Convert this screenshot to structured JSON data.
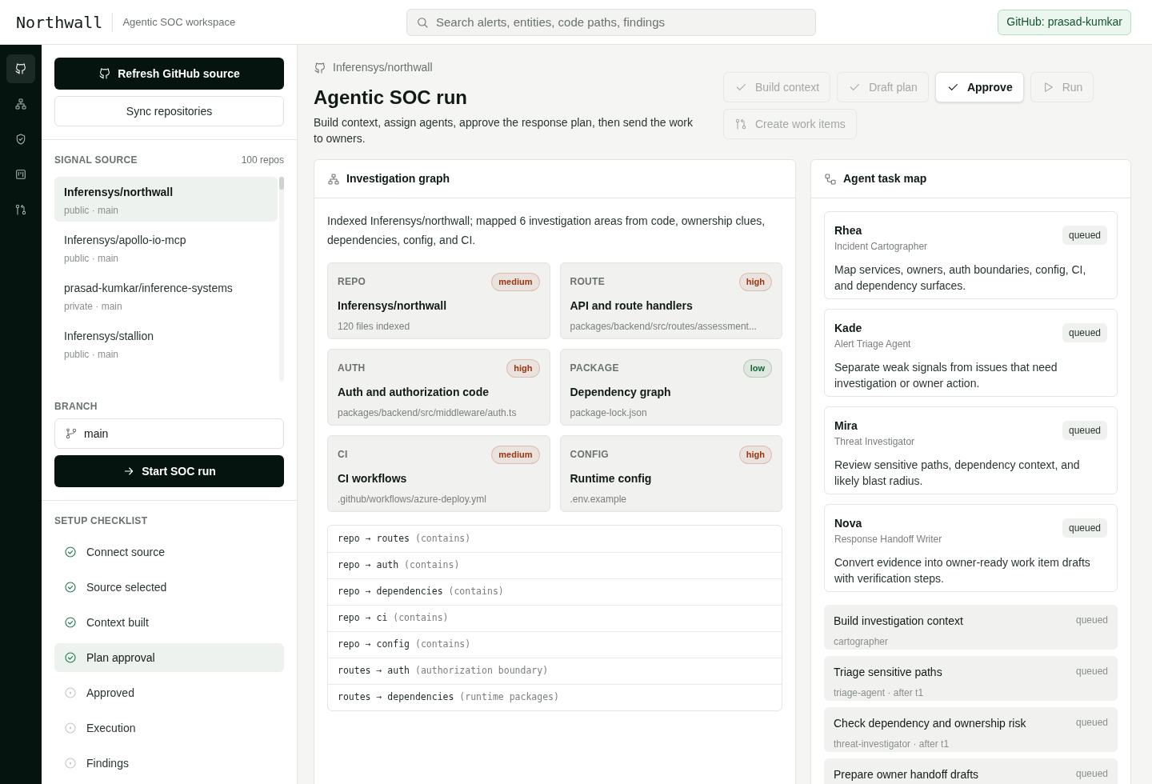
{
  "header": {
    "logo": "Northwall",
    "subtitle": "Agentic SOC workspace",
    "search_placeholder": "Search alerts, entities, code paths, findings",
    "account": "GitHub: prasad-kumkar"
  },
  "rail": [
    {
      "kind": "github",
      "selected": true
    },
    {
      "kind": "graph",
      "selected": false
    },
    {
      "kind": "shield",
      "selected": false
    },
    {
      "kind": "board",
      "selected": false
    },
    {
      "kind": "pull",
      "selected": false
    }
  ],
  "sidebar": {
    "refresh_button": "Refresh GitHub source",
    "sync_button": "Sync repositories",
    "source_label": "SIGNAL SOURCE",
    "source_count": "100 repos",
    "repos": [
      {
        "name": "Inferensys/northwall",
        "meta": "public · main",
        "selected": true
      },
      {
        "name": "Inferensys/apollo-io-mcp",
        "meta": "public · main",
        "selected": false
      },
      {
        "name": "prasad-kumkar/inference-systems",
        "meta": "private · main",
        "selected": false
      },
      {
        "name": "Inferensys/stallion",
        "meta": "public · main",
        "selected": false
      }
    ],
    "branch_label": "BRANCH",
    "branch_value": "main",
    "start_button": "Start SOC run",
    "checklist_label": "SETUP CHECKLIST",
    "checklist": [
      {
        "label": "Connect source",
        "done": true,
        "selected": false
      },
      {
        "label": "Source selected",
        "done": true,
        "selected": false
      },
      {
        "label": "Context built",
        "done": true,
        "selected": false
      },
      {
        "label": "Plan approval",
        "done": true,
        "selected": true
      },
      {
        "label": "Approved",
        "done": false,
        "selected": false
      },
      {
        "label": "Execution",
        "done": false,
        "selected": false
      },
      {
        "label": "Findings",
        "done": false,
        "selected": false
      }
    ]
  },
  "main": {
    "breadcrumb": "Inferensys/northwall",
    "title": "Agentic SOC run",
    "description": "Build context, assign agents, approve the response plan, then send the work to owners.",
    "actions": [
      {
        "label": "Build context",
        "kind": "check",
        "disabled": true
      },
      {
        "label": "Draft plan",
        "kind": "check",
        "disabled": true
      },
      {
        "label": "Approve",
        "kind": "check",
        "disabled": false
      },
      {
        "label": "Run",
        "kind": "play",
        "disabled": true
      },
      {
        "label": "Create work items",
        "kind": "handoff",
        "disabled": true
      }
    ]
  },
  "investigation": {
    "title": "Investigation graph",
    "summary": "Indexed Inferensys/northwall; mapped 6 investigation areas from code, ownership clues, dependencies, config, and CI.",
    "areas": [
      {
        "type": "REPO",
        "severity": "medium",
        "color": "#9a3412",
        "title": "Inferensys/northwall",
        "detail": "120 files indexed"
      },
      {
        "type": "ROUTE",
        "severity": "high",
        "color": "#9a3412",
        "title": "API and route handlers",
        "detail": "packages/backend/src/routes/assessment..."
      },
      {
        "type": "AUTH",
        "severity": "high",
        "color": "#9a3412",
        "title": "Auth and authorization code",
        "detail": "packages/backend/src/middleware/auth.ts"
      },
      {
        "type": "PACKAGE",
        "severity": "low",
        "color": "#166534",
        "title": "Dependency graph",
        "detail": "package-lock.json"
      },
      {
        "type": "CI",
        "severity": "medium",
        "color": "#9a3412",
        "title": "CI workflows",
        "detail": ".github/workflows/azure-deploy.yml"
      },
      {
        "type": "CONFIG",
        "severity": "high",
        "color": "#9a3412",
        "title": "Runtime config",
        "detail": ".env.example"
      }
    ],
    "edges": [
      {
        "from": "repo",
        "arrow": "→",
        "to": "routes",
        "relation": "(contains)"
      },
      {
        "from": "repo",
        "arrow": "→",
        "to": "auth",
        "relation": "(contains)"
      },
      {
        "from": "repo",
        "arrow": "→",
        "to": "dependencies",
        "relation": "(contains)"
      },
      {
        "from": "repo",
        "arrow": "→",
        "to": "ci",
        "relation": "(contains)"
      },
      {
        "from": "repo",
        "arrow": "→",
        "to": "config",
        "relation": "(contains)"
      },
      {
        "from": "routes",
        "arrow": "→",
        "to": "auth",
        "relation": "(authorization boundary)"
      },
      {
        "from": "routes",
        "arrow": "→",
        "to": "dependencies",
        "relation": "(runtime packages)"
      }
    ]
  },
  "agents": {
    "title": "Agent task map",
    "agents": [
      {
        "name": "Rhea",
        "role": "Incident Cartographer",
        "status": "queued",
        "task": "Map services, owners, auth boundaries, config, CI, and dependency surfaces."
      },
      {
        "name": "Kade",
        "role": "Alert Triage Agent",
        "status": "queued",
        "task": "Separate weak signals from issues that need investigation or owner action."
      },
      {
        "name": "Mira",
        "role": "Threat Investigator",
        "status": "queued",
        "task": "Review sensitive paths, dependency context, and likely blast radius."
      },
      {
        "name": "Nova",
        "role": "Response Handoff Writer",
        "status": "queued",
        "task": "Convert evidence into owner-ready work item drafts with verification steps."
      }
    ],
    "tasks": [
      {
        "title": "Build investigation context",
        "meta": "cartographer",
        "status": "queued"
      },
      {
        "title": "Triage sensitive paths",
        "meta": "triage-agent · after t1",
        "status": "queued"
      },
      {
        "title": "Check dependency and ownership risk",
        "meta": "threat-investigator · after t1",
        "status": "queued"
      },
      {
        "title": "Prepare owner handoff drafts",
        "status": "queued"
      }
    ]
  }
}
